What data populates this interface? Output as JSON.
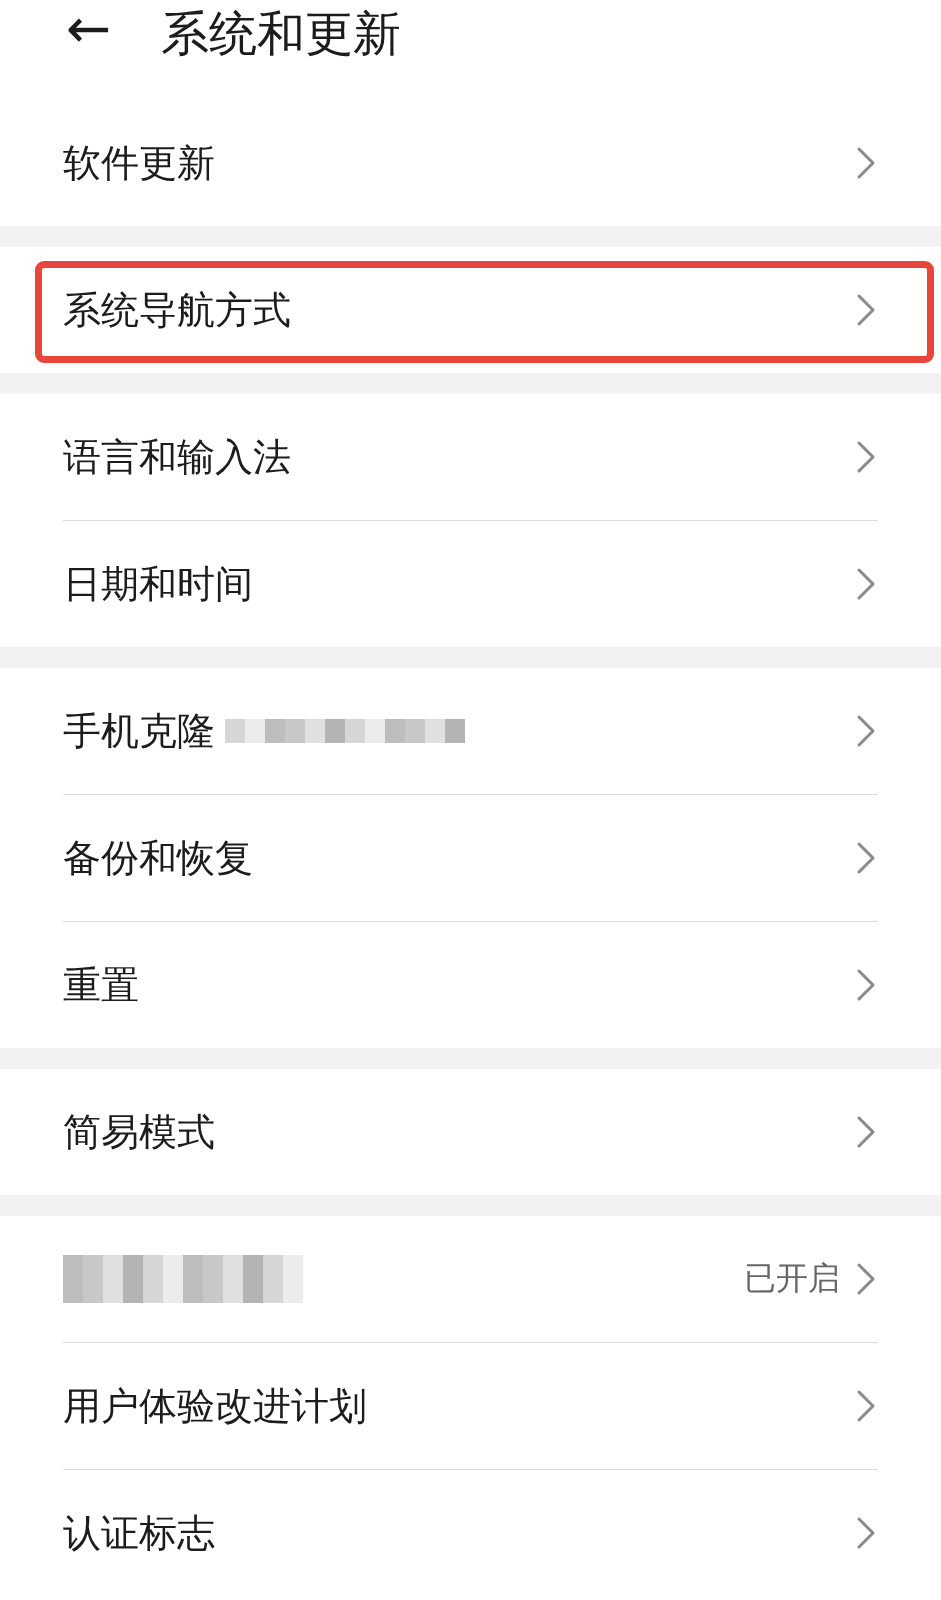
{
  "header": {
    "back": "←",
    "title": "系统和更新"
  },
  "groups": [
    {
      "items": [
        {
          "kind": "link",
          "label": "软件更新",
          "highlighted": false
        }
      ]
    },
    {
      "items": [
        {
          "kind": "link",
          "label": "系统导航方式",
          "highlighted": true
        }
      ]
    },
    {
      "items": [
        {
          "kind": "link",
          "label": "语言和输入法",
          "highlighted": false
        },
        {
          "kind": "link",
          "label": "日期和时间",
          "highlighted": false
        }
      ]
    },
    {
      "items": [
        {
          "kind": "redacted-partly",
          "label": "手机克隆",
          "highlighted": false
        },
        {
          "kind": "link",
          "label": "备份和恢复",
          "highlighted": false
        },
        {
          "kind": "link",
          "label": "重置",
          "highlighted": false
        }
      ]
    },
    {
      "items": [
        {
          "kind": "link",
          "label": "简易模式",
          "highlighted": false
        }
      ]
    },
    {
      "items": [
        {
          "kind": "redacted",
          "value": "已开启",
          "highlighted": false
        },
        {
          "kind": "link",
          "label": "用户体验改进计划",
          "highlighted": false
        },
        {
          "kind": "link",
          "label": "认证标志",
          "highlighted": false
        }
      ]
    }
  ]
}
